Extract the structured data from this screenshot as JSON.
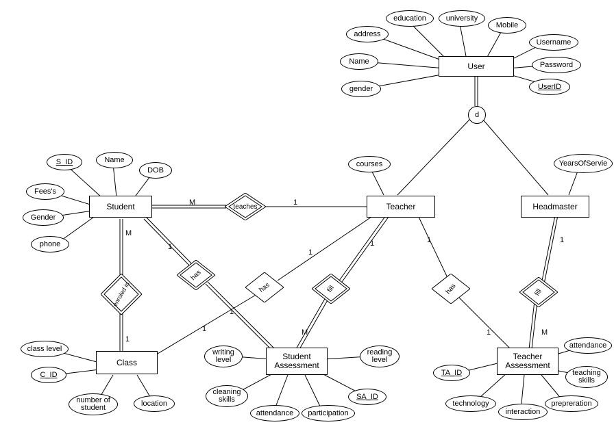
{
  "entities": {
    "user": "User",
    "student": "Student",
    "teacher": "Teacher",
    "headmaster": "Headmaster",
    "class": "Class",
    "studentAssessment": "Student\nAssessment",
    "teacherAssessment": "Teacher\nAssessment"
  },
  "attributes": {
    "user": {
      "address": "address",
      "education": "education",
      "university": "university",
      "mobile": "Mobile",
      "username": "Username",
      "password": "Password",
      "userid": "UserID",
      "name": "Name",
      "gender": "gender"
    },
    "student": {
      "sid": "S_ID",
      "name": "Name",
      "dob": "DOB",
      "fees": "Fees's",
      "gender": "Gender",
      "phone": "phone"
    },
    "teacher": {
      "courses": "courses"
    },
    "headmaster": {
      "years": "YearsOfServie"
    },
    "class": {
      "classlevel": "class level",
      "cid": "C_ID",
      "numstudent": "number of\nstudent",
      "location": "location"
    },
    "studentAssessment": {
      "writing": "writing\nlevel",
      "cleaning": "cleaning\nskills",
      "attendance": "attendance",
      "participation": "participation",
      "said": "SA_ID",
      "reading": "reading\nlevel"
    },
    "teacherAssessment": {
      "taid": "TA_ID",
      "technology": "technology",
      "interaction": "interaction",
      "prep": "prepreration",
      "teaching": "teaching\nskills",
      "attendance": "attendance"
    }
  },
  "relationships": {
    "teaches": "teaches",
    "enroled": "enroled in",
    "has1": "has",
    "has2": "has",
    "has3": "has",
    "fill1": "fill",
    "fill2": "fill"
  },
  "specialization": "d",
  "cardinalities": {
    "teaches_student": "M",
    "teaches_teacher": "1",
    "enroled_student": "M",
    "enroled_class": "1",
    "has1_student": "1",
    "has1_sa": "1",
    "has2_teacher": "1",
    "has2_class": "1",
    "fill1_teacher": "1",
    "fill1_sa": "M",
    "has3_teacher": "1",
    "has3_ta": "1",
    "fill2_head": "1",
    "fill2_ta": "M"
  }
}
